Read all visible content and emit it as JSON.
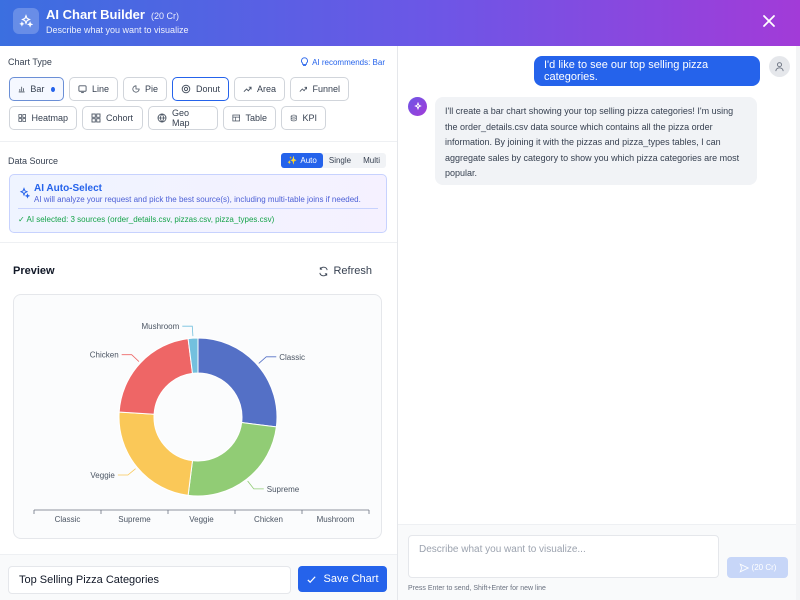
{
  "header": {
    "title": "AI Chart Builder",
    "credits": "(20 Cr)",
    "subtitle": "Describe what you want to visualize"
  },
  "chart_type": {
    "label": "Chart Type",
    "recommendation": "AI recommends: Bar",
    "options": [
      {
        "label": "Bar",
        "icon": "bar-chart-icon",
        "state": "recommended"
      },
      {
        "label": "Line",
        "icon": "line-chart-icon",
        "state": "normal"
      },
      {
        "label": "Pie",
        "icon": "pie-chart-icon",
        "state": "normal"
      },
      {
        "label": "Donut",
        "icon": "donut-chart-icon",
        "state": "selected"
      },
      {
        "label": "Area",
        "icon": "area-chart-icon",
        "state": "normal"
      },
      {
        "label": "Funnel",
        "icon": "funnel-chart-icon",
        "state": "normal"
      },
      {
        "label": "Heatmap",
        "icon": "heatmap-icon",
        "state": "normal"
      },
      {
        "label": "Cohort",
        "icon": "cohort-icon",
        "state": "normal"
      },
      {
        "label": "Geo Map",
        "icon": "globe-icon",
        "state": "normal"
      },
      {
        "label": "Table",
        "icon": "table-icon",
        "state": "normal"
      },
      {
        "label": "KPI",
        "icon": "database-icon",
        "state": "normal"
      }
    ]
  },
  "data_source": {
    "label": "Data Source",
    "modes": [
      "Auto",
      "Single",
      "Multi"
    ],
    "active_mode": "Auto",
    "ai_select_title": "AI Auto-Select",
    "ai_select_desc": "AI will analyze your request and pick the best source(s), including multi-table joins if needed.",
    "ai_selected": "✓ AI selected: 3 sources (order_details.csv, pizzas.csv, pizza_types.csv)"
  },
  "preview": {
    "title": "Preview",
    "refresh_label": "Refresh"
  },
  "chart_data": {
    "type": "pie",
    "variant": "donut",
    "categories": [
      "Classic",
      "Supreme",
      "Veggie",
      "Chicken",
      "Mushroom"
    ],
    "values": [
      27,
      25,
      24,
      22,
      2
    ],
    "colors": [
      "#5470c6",
      "#91cc75",
      "#fac858",
      "#ee6666",
      "#73c0de"
    ],
    "legend_position": "bottom"
  },
  "footer": {
    "chart_name": "Top Selling Pizza Categories",
    "save_label": "Save Chart"
  },
  "chat": {
    "user_message": "I'd like to see our top selling pizza categories.",
    "bot_message": "I'll create a bar chart showing your top selling pizza categories! I'm using the order_details.csv data source which contains all the pizza order information. By joining it with the pizzas and pizza_types tables, I can aggregate sales by category to show you which pizza categories are most popular.",
    "input_placeholder": "Describe what you want to visualize...",
    "send_credits": "(20 Cr)",
    "hint": "Press Enter to send, Shift+Enter for new line"
  }
}
